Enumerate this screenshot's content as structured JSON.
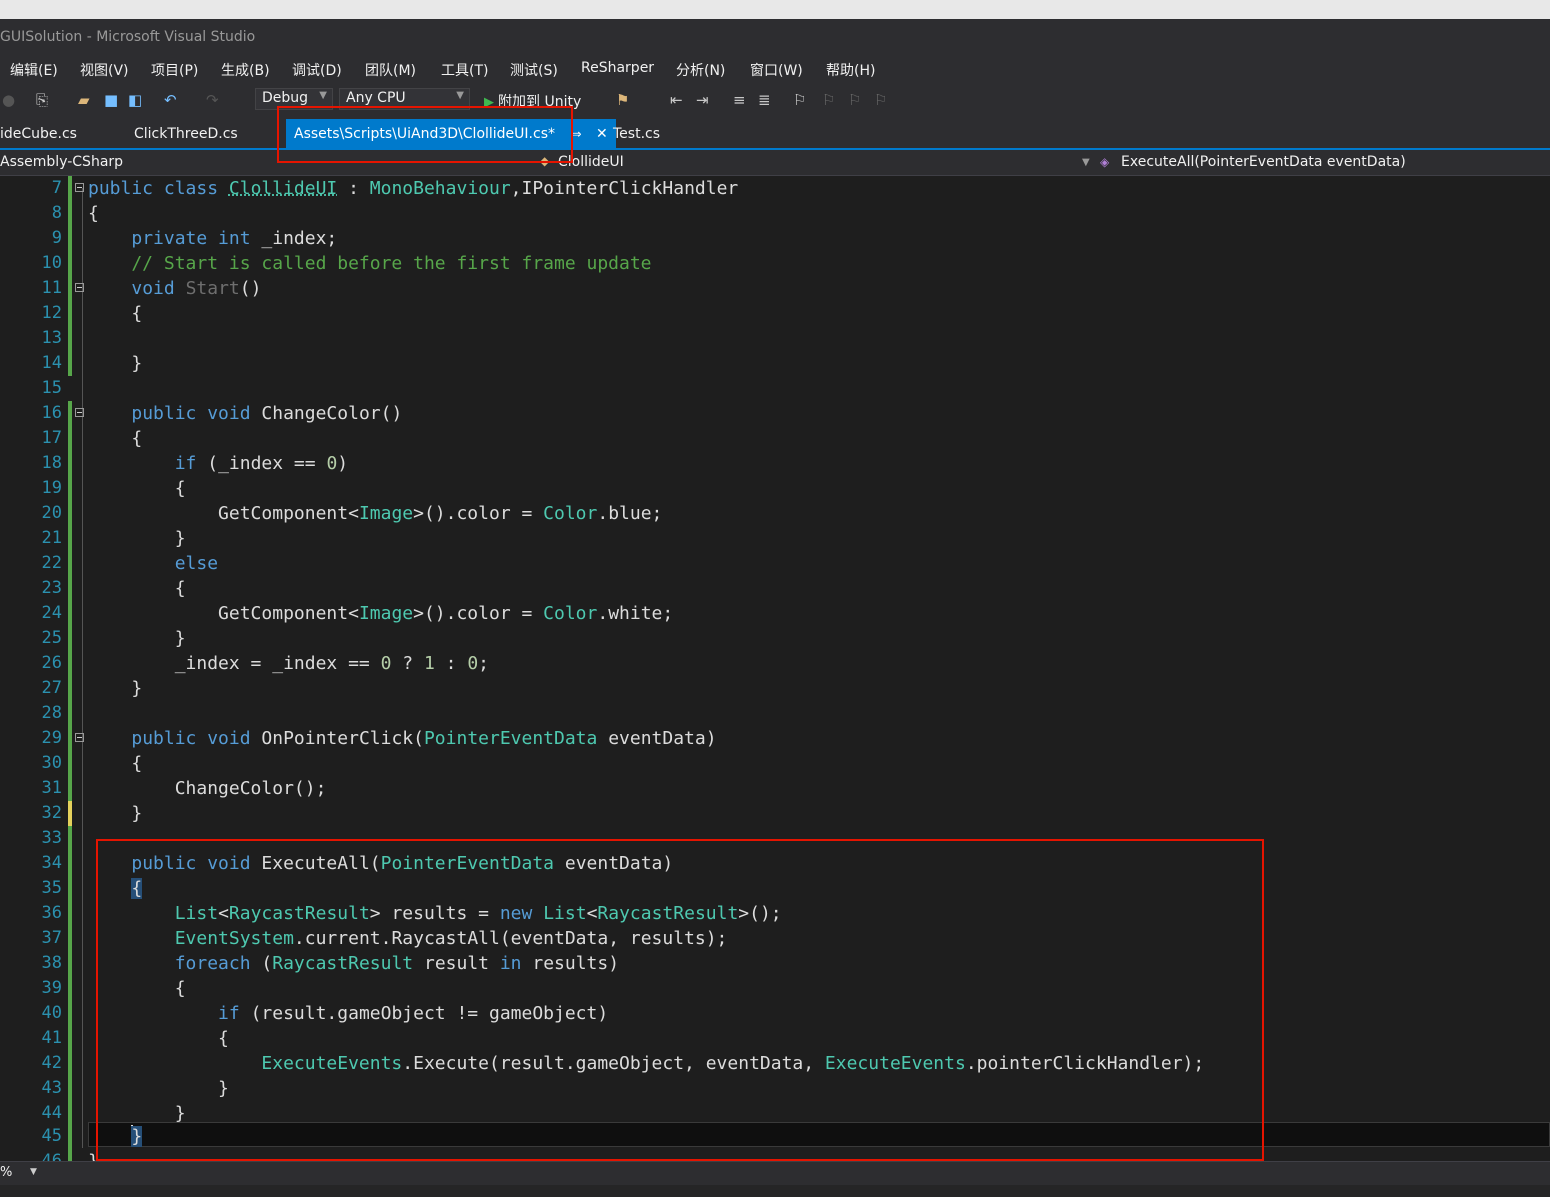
{
  "window": {
    "title": "GUISolution - Microsoft Visual Studio"
  },
  "menu": [
    "编辑(E)",
    "视图(V)",
    "项目(P)",
    "生成(B)",
    "调试(D)",
    "团队(M)",
    "工具(T)",
    "测试(S)",
    "ReSharper",
    "分析(N)",
    "窗口(W)",
    "帮助(H)"
  ],
  "toolbar": {
    "config": "Debug",
    "platform": "Any CPU",
    "attach_label": "附加到 Unity"
  },
  "tabs": [
    {
      "label": "ideCube.cs",
      "active": false
    },
    {
      "label": "ClickThreeD.cs",
      "active": false
    },
    {
      "label": "Assets\\Scripts\\UiAnd3D\\ClollideUI.cs*",
      "active": true
    },
    {
      "label": "Test.cs",
      "active": false
    }
  ],
  "nav": {
    "project": "Assembly-CSharp",
    "type": "ClollideUI",
    "member": "ExecuteAll(PointerEventData eventData)"
  },
  "code_lines": [
    {
      "n": "7",
      "text": "public class ClollideUI : MonoBehaviour,IPointerClickHandler"
    },
    {
      "n": "8",
      "text": "{"
    },
    {
      "n": "9",
      "text": "    private int _index;"
    },
    {
      "n": "10",
      "text": "    // Start is called before the first frame update"
    },
    {
      "n": "11",
      "text": "    void Start()"
    },
    {
      "n": "12",
      "text": "    {"
    },
    {
      "n": "13",
      "text": ""
    },
    {
      "n": "14",
      "text": "    }"
    },
    {
      "n": "15",
      "text": ""
    },
    {
      "n": "16",
      "text": "    public void ChangeColor()"
    },
    {
      "n": "17",
      "text": "    {"
    },
    {
      "n": "18",
      "text": "        if (_index == 0)"
    },
    {
      "n": "19",
      "text": "        {"
    },
    {
      "n": "20",
      "text": "            GetComponent<Image>().color = Color.blue;"
    },
    {
      "n": "21",
      "text": "        }"
    },
    {
      "n": "22",
      "text": "        else"
    },
    {
      "n": "23",
      "text": "        {"
    },
    {
      "n": "24",
      "text": "            GetComponent<Image>().color = Color.white;"
    },
    {
      "n": "25",
      "text": "        }"
    },
    {
      "n": "26",
      "text": "        _index = _index == 0 ? 1 : 0;"
    },
    {
      "n": "27",
      "text": "    }"
    },
    {
      "n": "28",
      "text": ""
    },
    {
      "n": "29",
      "text": "    public void OnPointerClick(PointerEventData eventData)"
    },
    {
      "n": "30",
      "text": "    {"
    },
    {
      "n": "31",
      "text": "        ChangeColor();"
    },
    {
      "n": "32",
      "text": "    }"
    },
    {
      "n": "33",
      "text": ""
    },
    {
      "n": "34",
      "text": "    public void ExecuteAll(PointerEventData eventData)"
    },
    {
      "n": "35",
      "text": "    {"
    },
    {
      "n": "36",
      "text": "        List<RaycastResult> results = new List<RaycastResult>();"
    },
    {
      "n": "37",
      "text": "        EventSystem.current.RaycastAll(eventData, results);"
    },
    {
      "n": "38",
      "text": "        foreach (RaycastResult result in results)"
    },
    {
      "n": "39",
      "text": "        {"
    },
    {
      "n": "40",
      "text": "            if (result.gameObject != gameObject)"
    },
    {
      "n": "41",
      "text": "            {"
    },
    {
      "n": "42",
      "text": "                ExecuteEvents.Execute(result.gameObject, eventData, ExecuteEvents.pointerClickHandler);"
    },
    {
      "n": "43",
      "text": "            }"
    },
    {
      "n": "44",
      "text": "        }"
    },
    {
      "n": "45",
      "text": "    }"
    },
    {
      "n": "46",
      "text": "}"
    }
  ],
  "status": {
    "zoom": "%"
  },
  "colors": {
    "accent": "#007acc",
    "highlight_box": "#e51400",
    "keyword": "#569cd6",
    "type": "#4ec9b0",
    "comment": "#57a64a"
  }
}
